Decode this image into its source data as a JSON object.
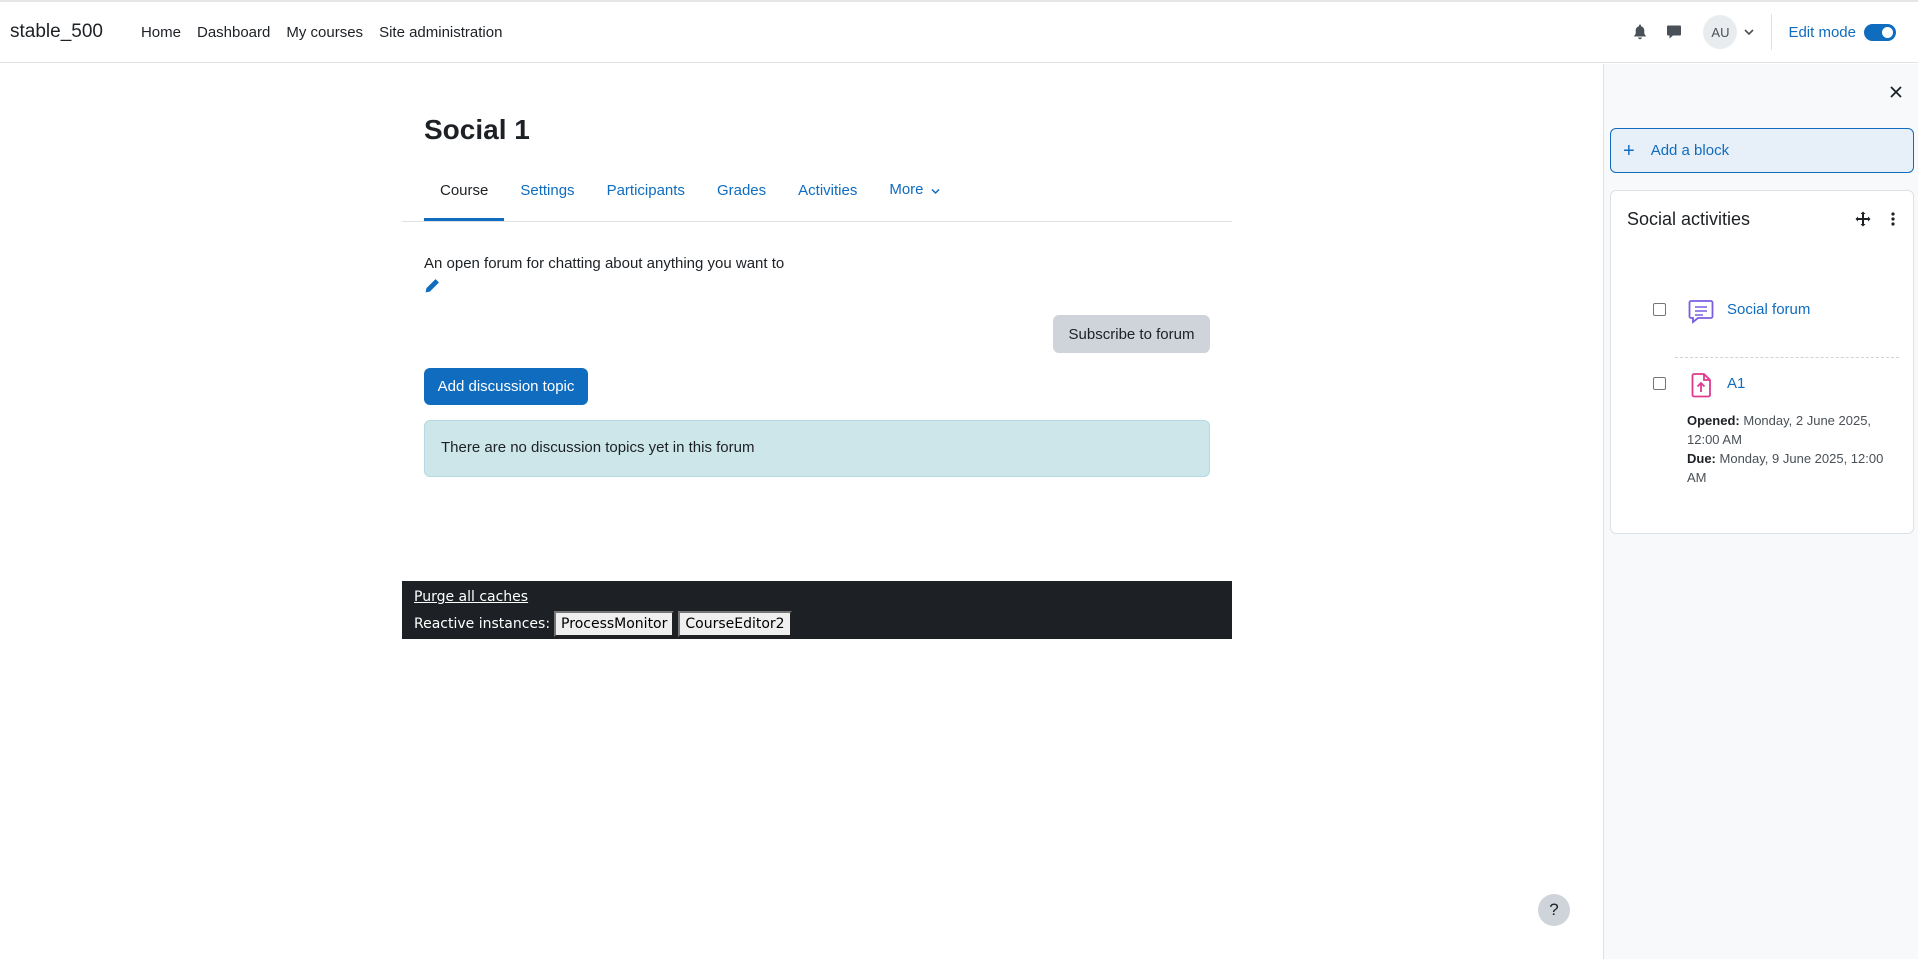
{
  "navbar": {
    "brand": "stable_500",
    "links": [
      "Home",
      "Dashboard",
      "My courses",
      "Site administration"
    ],
    "avatar_initials": "AU",
    "edit_mode_label": "Edit mode"
  },
  "page": {
    "title": "Social 1",
    "tabs": [
      "Course",
      "Settings",
      "Participants",
      "Grades",
      "Activities",
      "More"
    ],
    "intro": "An open forum for chatting about anything you want to",
    "subscribe_label": "Subscribe to forum",
    "add_topic_label": "Add discussion topic",
    "empty_notice": "There are no discussion topics yet in this forum"
  },
  "dev_footer": {
    "purge_label": "Purge all caches",
    "reactive_label": "Reactive instances:",
    "instances": [
      "ProcessMonitor",
      "CourseEditor2"
    ]
  },
  "help_label": "?",
  "drawer": {
    "add_block_label": "Add a block",
    "block_title": "Social activities",
    "activities": [
      {
        "name": "Social forum",
        "icon": "forum-icon"
      },
      {
        "name": "A1",
        "icon": "assignment-upload-icon",
        "opened_label": "Opened:",
        "opened_value": "Monday, 2 June 2025, 12:00 AM",
        "due_label": "Due:",
        "due_value": "Monday, 9 June 2025, 12:00 AM"
      }
    ]
  },
  "colors": {
    "primary": "#0f6cbf",
    "forum_icon": "#7b5ee0",
    "assignment_icon": "#e0398d",
    "footer_bg": "#1d2125",
    "info_bg": "#cce6ea"
  }
}
